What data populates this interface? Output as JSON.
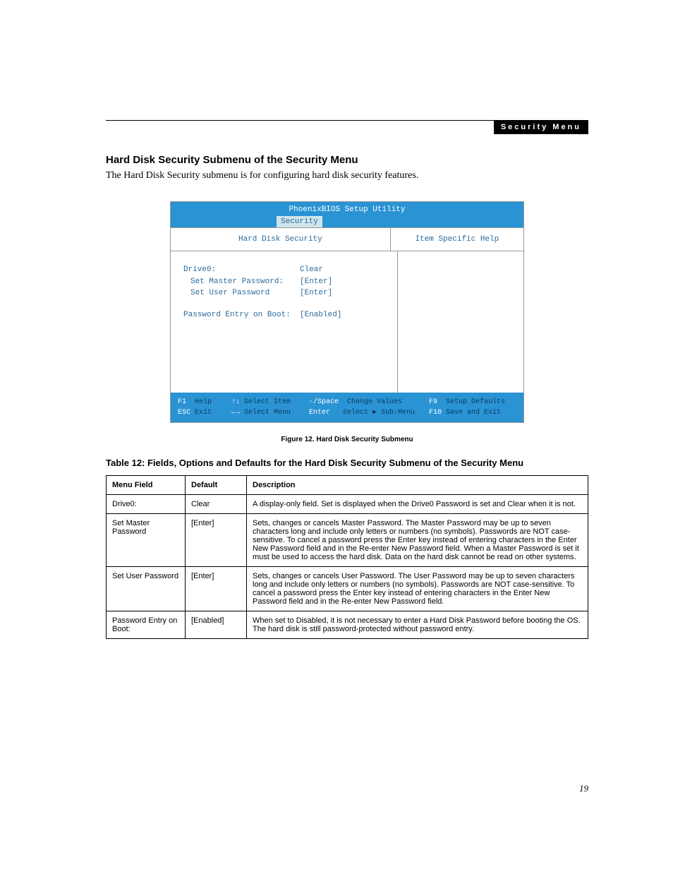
{
  "header": {
    "bar_label": "Security Menu"
  },
  "section": {
    "title": "Hard Disk Security Submenu of the Security Menu",
    "text": "The Hard Disk Security submenu is for configuring hard disk security features."
  },
  "bios": {
    "title": "PhoenixBIOS Setup Utility",
    "tab": "Security",
    "left_heading": "Hard Disk Security",
    "right_heading": "Item Specific Help",
    "rows": {
      "drive0_label": "Drive0:",
      "drive0_value": "Clear",
      "set_master_label": "Set Master Password:",
      "set_master_value": "[Enter]",
      "set_user_label": "Set User Password",
      "set_user_value": "[Enter]",
      "pw_boot_label": "Password Entry on Boot:",
      "pw_boot_value": "[Enabled]"
    },
    "footer": {
      "r1": {
        "k1": "F1",
        "t1": "Help",
        "k2": "↑↓",
        "t2": "Select Item",
        "k3": "-/Space",
        "t3": "Change Values",
        "k4": "F9",
        "t4": "Setup Defaults"
      },
      "r2": {
        "k1": "ESC",
        "t1": "Exit",
        "k2": "←→",
        "t2": "Select Menu",
        "k3": "Enter",
        "t3": "Select ▶ Sub-Menu",
        "k4": "F10",
        "t4": "Save and Exit"
      }
    }
  },
  "figure_caption": "Figure 12.   Hard Disk Security Submenu",
  "table": {
    "title": "Table 12: Fields, Options and Defaults for the Hard Disk Security Submenu of the Security Menu",
    "headers": {
      "c1": "Menu Field",
      "c2": "Default",
      "c3": "Description"
    },
    "rows": [
      {
        "field": "Drive0:",
        "default": "Clear",
        "desc": "A display-only field. Set is displayed when the Drive0 Password is set and Clear when it is not."
      },
      {
        "field": "Set Master Password",
        "default": "[Enter]",
        "desc": "Sets, changes or cancels Master Password. The Master Password may be up to seven characters long and include only letters or numbers (no symbols). Passwords are NOT case-sensitive. To cancel a password press the Enter key instead of entering characters in the Enter New Password field and in the Re-enter New Password field. When a Master Password is set it must be used to access the hard disk. Data on the hard disk cannot be read on other systems."
      },
      {
        "field": "Set User Password",
        "default": "[Enter]",
        "desc": "Sets, changes or cancels User Password. The User Password may be up to seven characters long and include only letters or numbers (no symbols). Passwords are NOT case-sensitive. To cancel a password press the Enter key instead of entering characters in the Enter New Password field and in the Re-enter New Password field."
      },
      {
        "field": "Password Entry on Boot:",
        "default": "[Enabled]",
        "desc": "When set to Disabled, it is not necessary to enter a Hard Disk Password before booting the OS. The hard disk is still password-protected without password entry."
      }
    ]
  },
  "page_number": "19"
}
